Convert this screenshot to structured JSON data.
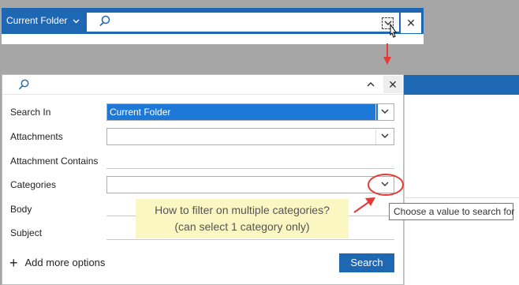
{
  "top_bar": {
    "scope_label": "Current Folder",
    "close_glyph": "✕"
  },
  "panel": {
    "collapse_glyph": "^",
    "close_glyph": "✕",
    "fields": [
      {
        "label": "Search In",
        "value": "Current Folder"
      },
      {
        "label": "Attachments",
        "value": ""
      },
      {
        "label": "Attachment Contains",
        "value": ""
      },
      {
        "label": "Categories",
        "value": ""
      },
      {
        "label": "Body",
        "value": ""
      },
      {
        "label": "Subject",
        "value": ""
      }
    ],
    "add_more_label": "Add more options",
    "search_button": "Search"
  },
  "callout": {
    "line1": "How to filter on multiple categories?",
    "line2": "(can select 1 category only)"
  },
  "tooltip": "Choose a value to search for",
  "colors": {
    "accent": "#1e67b3",
    "selection": "#1e78d7",
    "callout_bg": "#fbf7c2",
    "annotation_red": "#e53935"
  }
}
